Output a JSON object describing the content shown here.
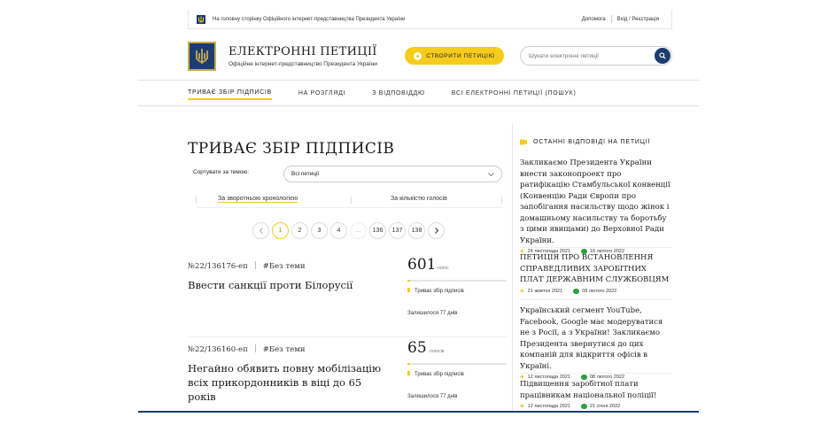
{
  "topbar": {
    "home_link": "На головну сторінку Офіційного інтернет-представництва Президента України",
    "help": "Допомога",
    "login": "Вхід / Реєстрація"
  },
  "header": {
    "title": "ЕЛЕКТРОННІ ПЕТИЦІЇ",
    "subtitle": "Офіційне інтернет-представництво Президента України",
    "create_button": "СТВОРИТИ ПЕТИЦІЮ",
    "search_placeholder": "Шукати електронні петиції"
  },
  "nav": {
    "items": [
      {
        "label": "ТРИВАЄ ЗБІР ПІДПИСІВ",
        "active": true
      },
      {
        "label": "НА РОЗГЛЯДІ",
        "active": false
      },
      {
        "label": "З ВІДПОВІДДЮ",
        "active": false
      },
      {
        "label": "ВСІ ЕЛЕКТРОННІ ПЕТИЦІЇ (ПОШУК)",
        "active": false
      }
    ]
  },
  "main": {
    "page_title": "ТРИВАЄ ЗБІР ПІДПИСІВ",
    "sort_label": "Сортувати за темою:",
    "sort_value": "Всі петиції",
    "order_reverse": "За зворотньою хронологією",
    "order_votes": "За кількістю голосів",
    "pager": [
      "1",
      "2",
      "3",
      "4",
      "...",
      "136",
      "137",
      "138"
    ],
    "petitions": [
      {
        "number": "№22/136176-еп",
        "tag": "#Без теми",
        "title": "Ввести санкції проти Білорусії",
        "count": "601",
        "count_label": "голос",
        "progress": 0.024,
        "status": "Триває збір підписів",
        "remaining": "Залишилося 77 днів"
      },
      {
        "number": "№22/136160-еп",
        "tag": "#Без теми",
        "title": "Негайно обявить повну мобілізацію всіх прикордонників в віці до 65 років",
        "count": "65",
        "count_label": "голосів",
        "progress": 0.003,
        "status": "Триває збір підписів",
        "remaining": "Залишилося 77 днів"
      }
    ]
  },
  "aside": {
    "heading": "ОСТАННІ ВІДПОВІДІ НА ПЕТИЦІЇ",
    "answers": [
      {
        "title": "Закликаємо Президента України внести законопроект про ратифікацію Стамбульської конвенції (Конвенцію Ради Європи про запобігання насильству щодо жінок і домашньому насильству та боротьбу з цими явищами) до Верховної Ради України.",
        "created": "24 листопада 2021",
        "answered": "16 лютого 2022"
      },
      {
        "title": "ПЕТИЦІЯ ПРО ВСТАНОВЛЕННЯ СПРАВЕДЛИВИХ ЗАРОБІТНИХ ПЛАТ ДЕРЖАВНИМ СЛУЖБОВЦЯМ",
        "created": "21 жовтня 2021",
        "answered": "08 лютого 2022"
      },
      {
        "title": "Український сегмент YouTube, Facebook, Google має модеруватися не з Росії, а з України! Закликаємо Президента звернутися до цих компаній для відкриття офісів в Україні.",
        "created": "12 листопада 2021",
        "answered": "08 лютого 2022"
      },
      {
        "title": "Підвищення заробітної плати працівникам національної поліції!",
        "created": "12 листопада 2021",
        "answered": "21 січня 2022"
      }
    ]
  },
  "colors": {
    "accent": "#f5cc1b",
    "brand": "#1d3d6e",
    "answered": "#2e9e3e"
  },
  "icons": [
    "trident-icon",
    "plus-icon",
    "search-icon",
    "chevron-left-icon",
    "chevron-right-icon",
    "answers-icon",
    "comment-icon"
  ]
}
